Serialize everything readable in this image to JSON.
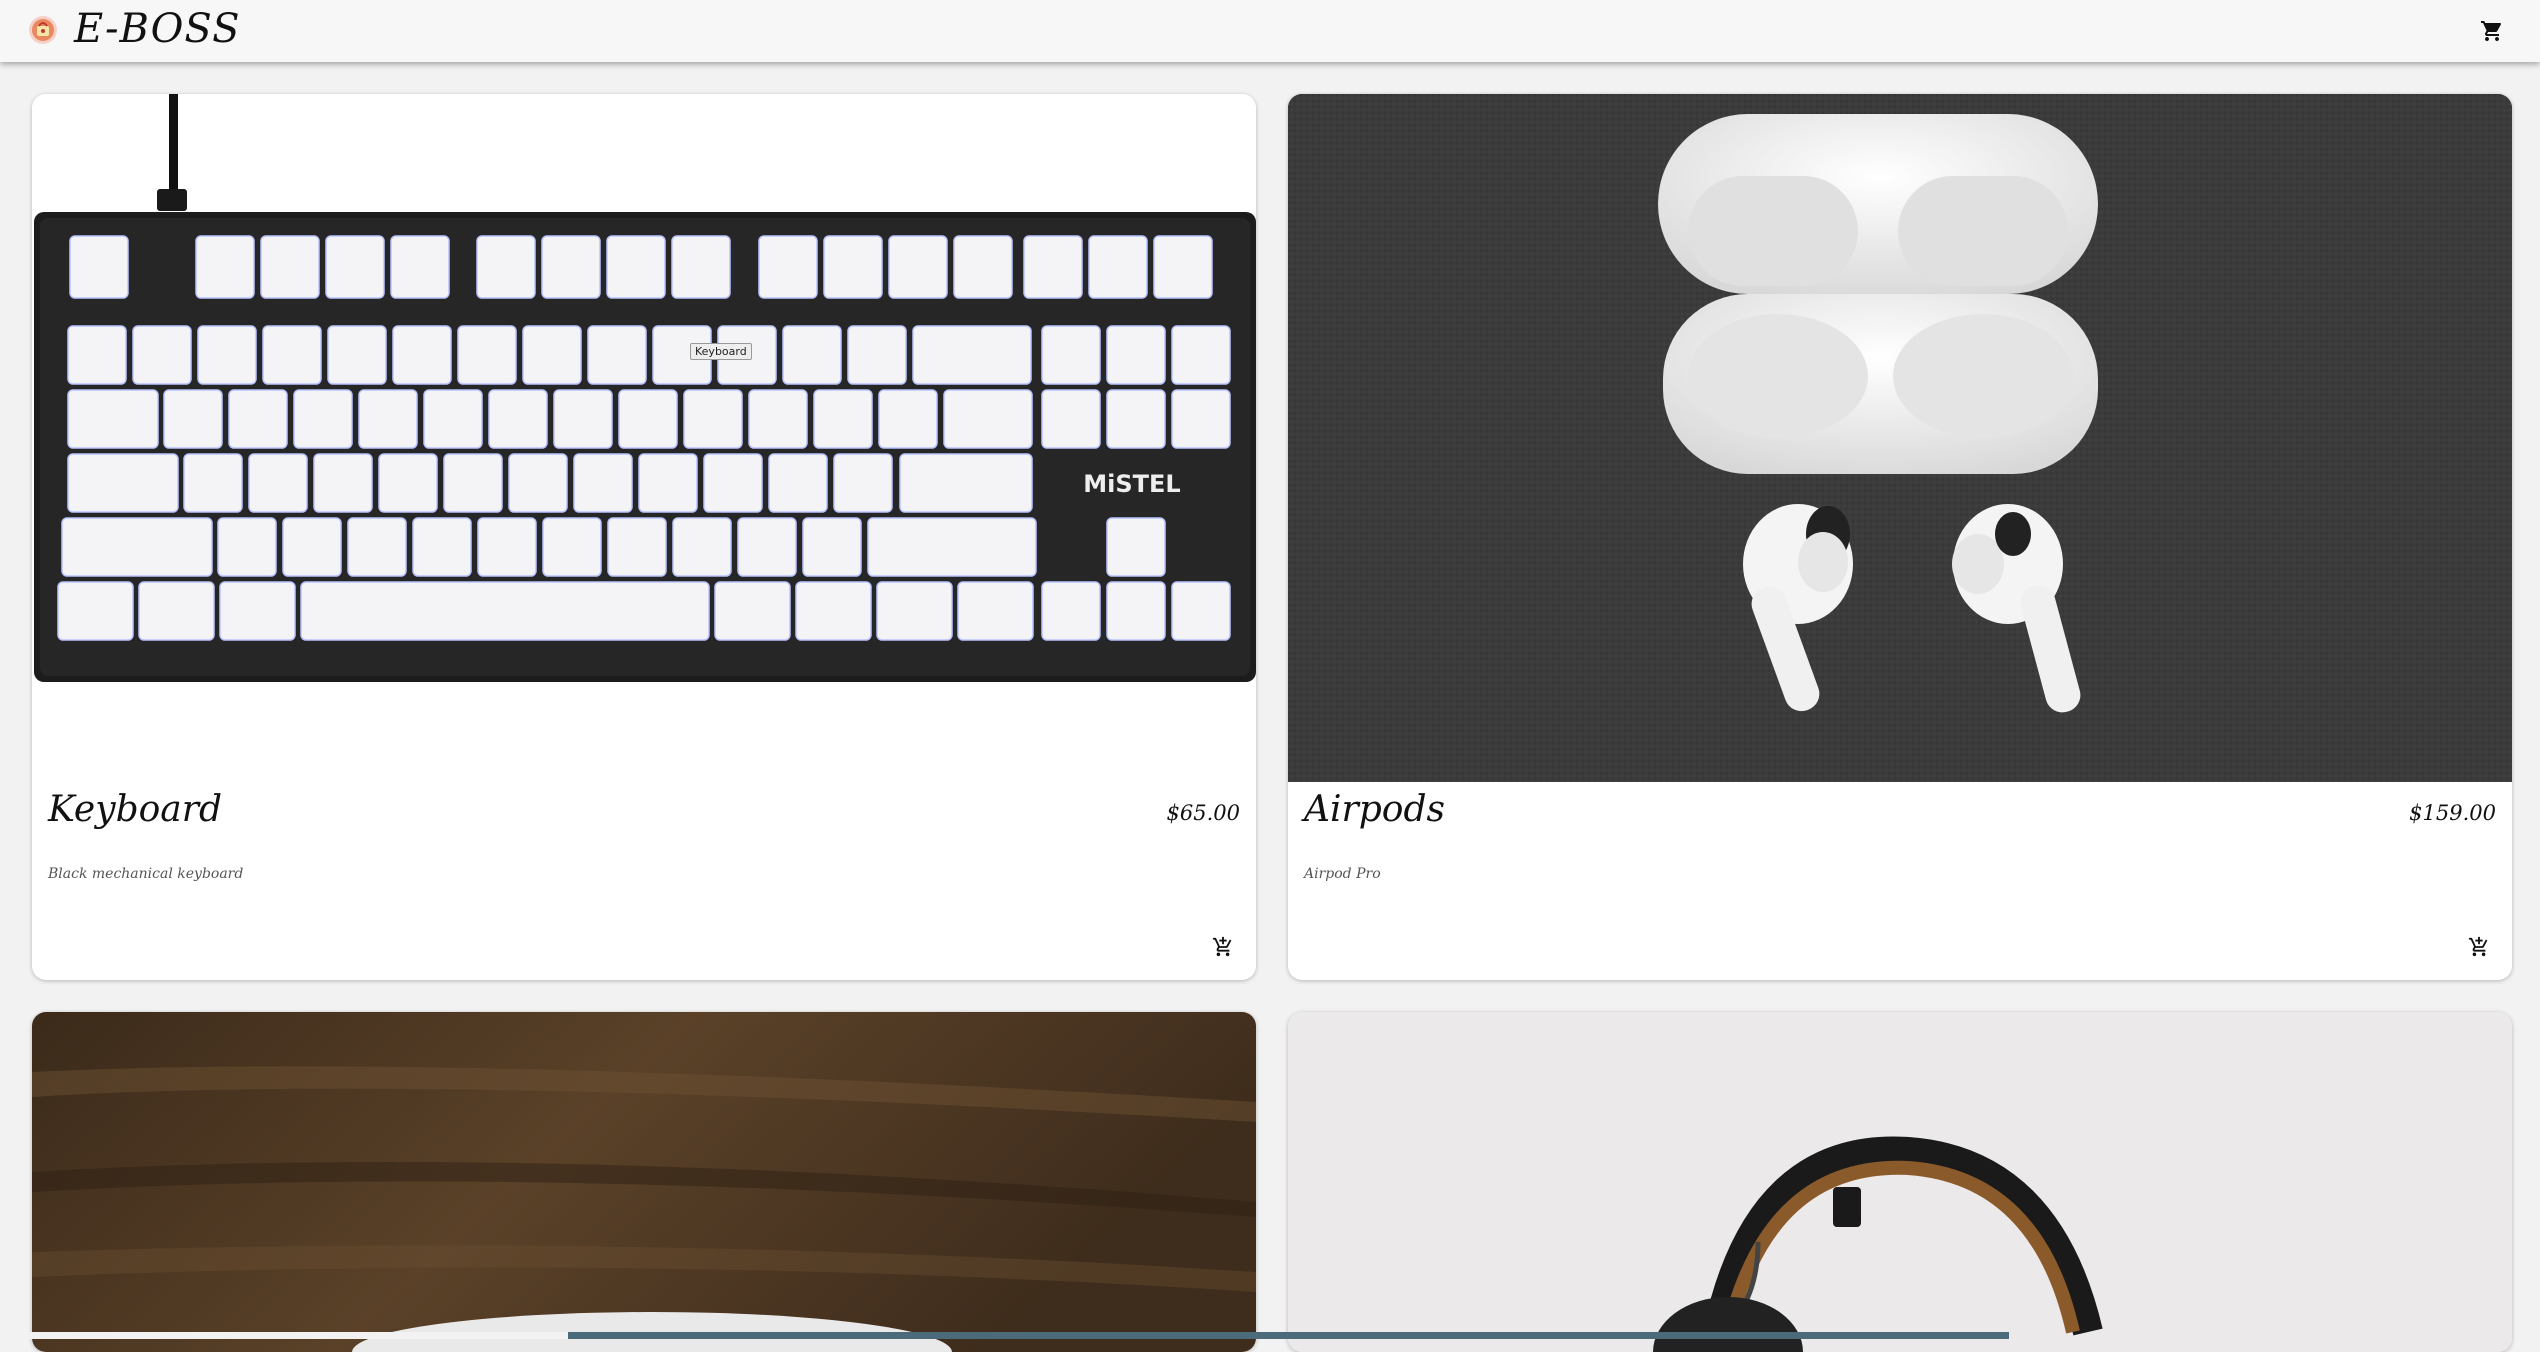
{
  "app": {
    "brand": "E-BOSS",
    "logo_icon": "shopping-bag-logo-icon",
    "cart_icon": "shopping-cart-icon"
  },
  "products": [
    {
      "title": "Keyboard",
      "price": "$65.00",
      "description": "Black mechanical keyboard",
      "add_icon": "add-shopping-cart-icon"
    },
    {
      "title": "Airpods",
      "price": "$159.00",
      "description": "Airpod Pro",
      "add_icon": "add-shopping-cart-icon"
    }
  ],
  "tooltip": "Keyboard",
  "keyboard_brand": "MiSTEL",
  "colors": {
    "appbar": "#f7f7f7",
    "card": "#ffffff",
    "background": "#f2f2f2",
    "airpods_bg": "#3a3a3a",
    "wood": "#4a3522"
  }
}
